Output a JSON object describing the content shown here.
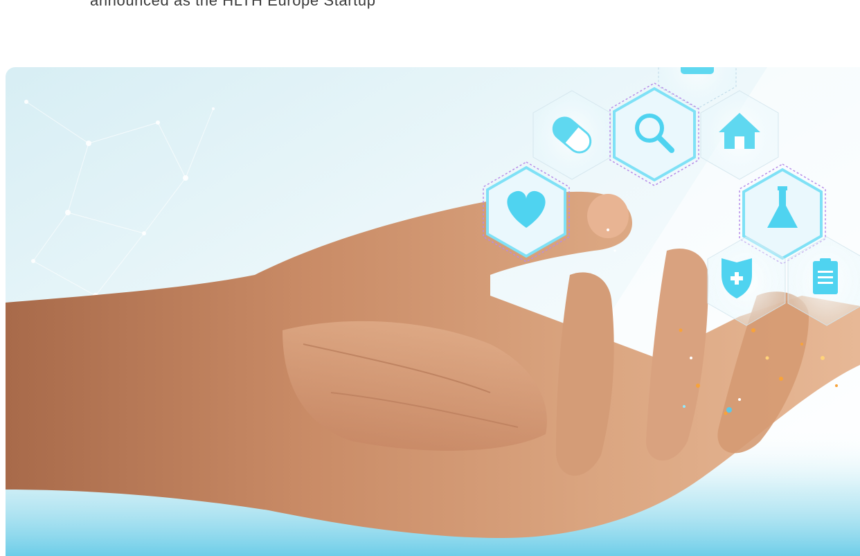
{
  "intro": {
    "text": "announced as the HLTH Europe Startup"
  },
  "hero_image": {
    "icons": [
      "first-aid-kit-icon",
      "pill-capsule-icon",
      "search-magnifier-icon",
      "home-icon",
      "heart-icon",
      "lab-flask-icon",
      "shield-plus-icon",
      "clipboard-icon"
    ],
    "colors": {
      "accent": "#4fd3f0",
      "glow": "#8fe9ff",
      "skin": "#d9a27f",
      "background": "#dff2f7",
      "sparkle": "#f7a33a"
    }
  }
}
